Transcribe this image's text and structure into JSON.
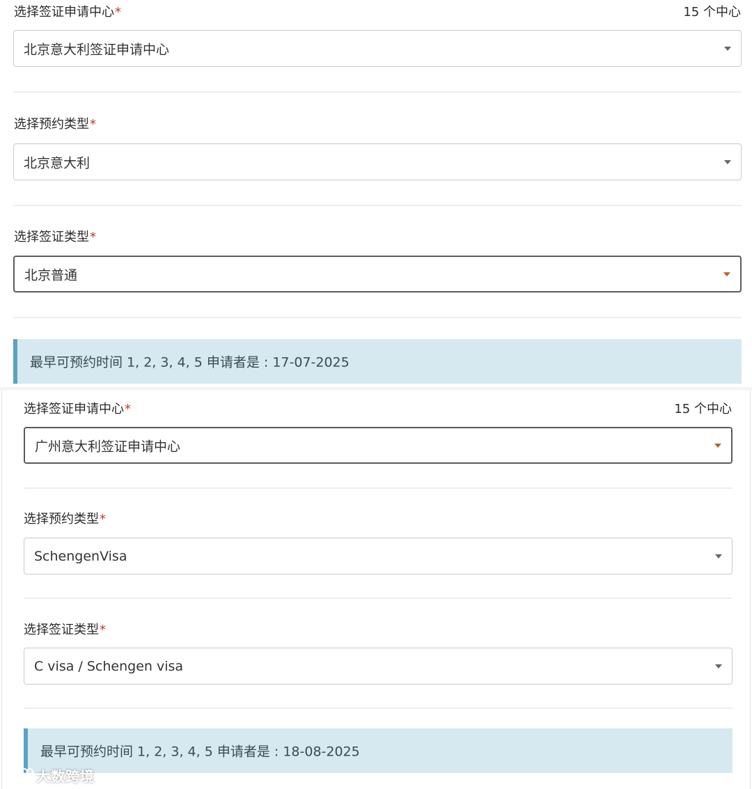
{
  "forms": [
    {
      "center": {
        "label": "选择签证申请中心",
        "required_mark": "*",
        "count": "15 个中心",
        "value": "北京意大利签证申请中心"
      },
      "appointment_type": {
        "label": "选择预约类型",
        "required_mark": "*",
        "value": "北京意大利"
      },
      "visa_type": {
        "label": "选择签证类型",
        "required_mark": "*",
        "value": "北京普通"
      },
      "notice": "最早可预约时间 1, 2, 3, 4, 5 申请者是 : 17-07-2025"
    },
    {
      "center": {
        "label": "选择签证申请中心",
        "required_mark": "*",
        "count": "15 个中心",
        "value": "广州意大利签证申请中心"
      },
      "appointment_type": {
        "label": "选择预约类型",
        "required_mark": "*",
        "value": "SchengenVisa"
      },
      "visa_type": {
        "label": "选择签证类型",
        "required_mark": "*",
        "value": "C visa / Schengen visa"
      },
      "notice": "最早可预约时间 1, 2, 3, 4, 5 申请者是 : 18-08-2025"
    }
  ],
  "watermark": {
    "text": "大数跨境",
    "icon": "weibo-logo-icon"
  },
  "colors": {
    "accent_notice_bg": "#d7e9f0",
    "accent_notice_border": "#5ba3c0",
    "required": "#c0392b"
  }
}
